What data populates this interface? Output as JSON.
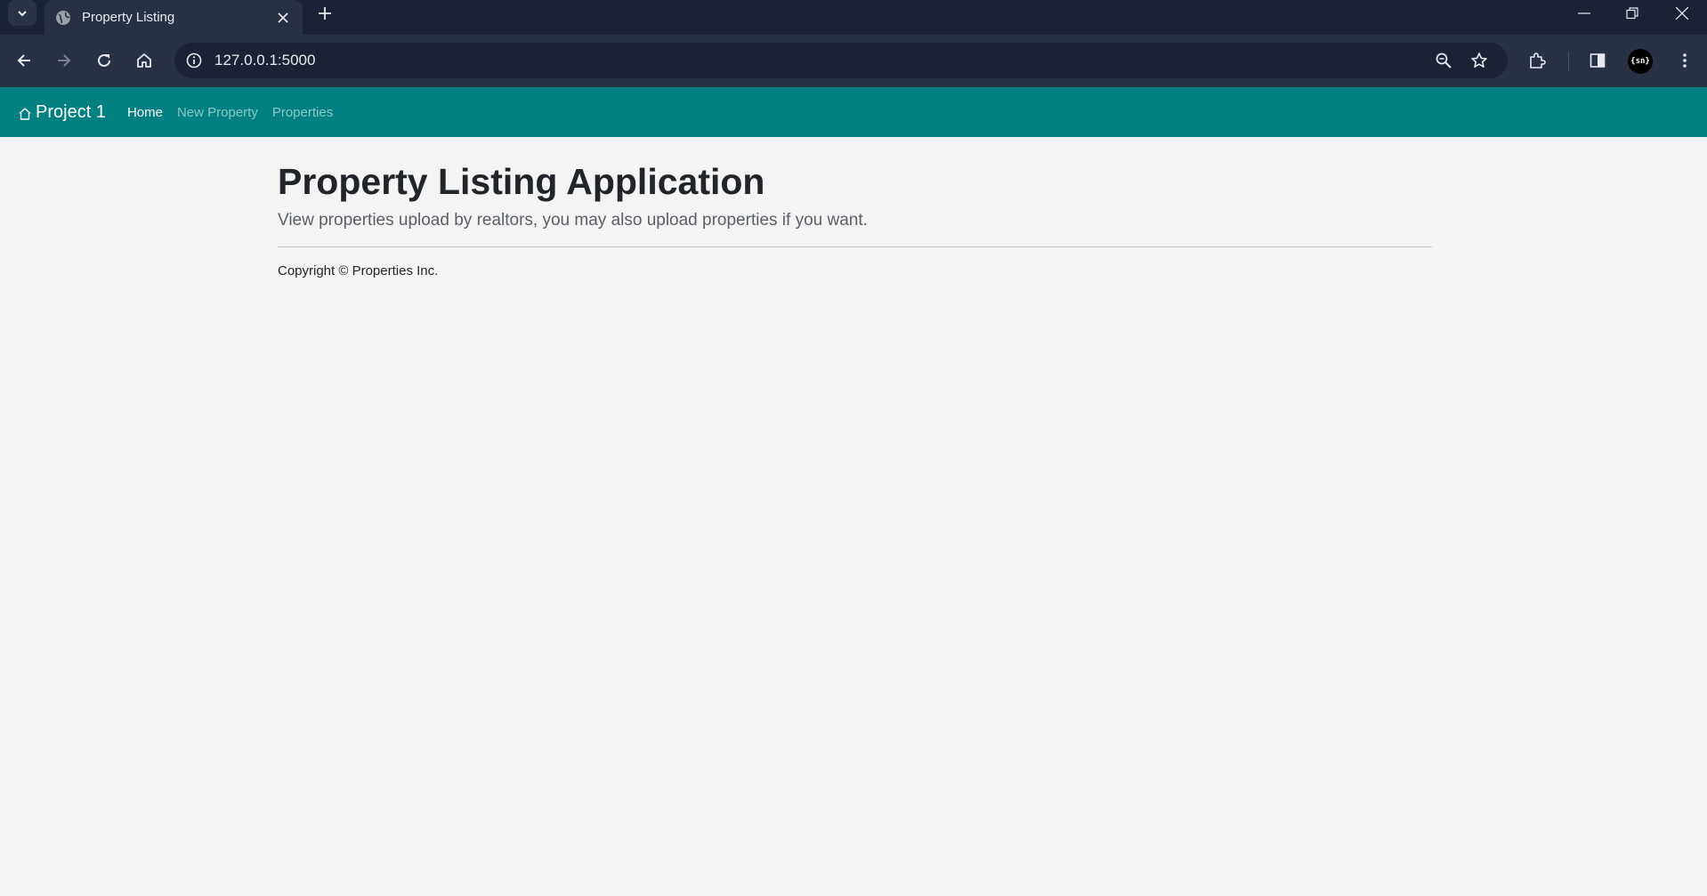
{
  "browser": {
    "tab_title": "Property Listing",
    "url": "127.0.0.1:5000",
    "profile_label": "{sn}"
  },
  "navbar": {
    "brand": "Project 1",
    "links": [
      {
        "label": "Home",
        "active": true
      },
      {
        "label": "New Property",
        "active": false
      },
      {
        "label": "Properties",
        "active": false
      }
    ]
  },
  "main": {
    "title": "Property Listing Application",
    "lead": "View properties upload by realtors, you may also upload properties if you want.",
    "footer": "Copyright © Properties Inc."
  },
  "colors": {
    "navbar_bg": "#008080",
    "page_bg": "#f4f4f4",
    "chrome_dark": "#1b2233",
    "chrome_toolbar": "#283043"
  },
  "icons": [
    "tab-search-icon",
    "globe-icon",
    "close-icon",
    "plus-icon",
    "minimize-icon",
    "restore-icon",
    "window-close-icon",
    "back-icon",
    "forward-icon",
    "reload-icon",
    "home-icon",
    "info-icon",
    "zoom-icon",
    "star-icon",
    "extensions-icon",
    "side-panel-icon",
    "more-icon",
    "house-icon"
  ]
}
